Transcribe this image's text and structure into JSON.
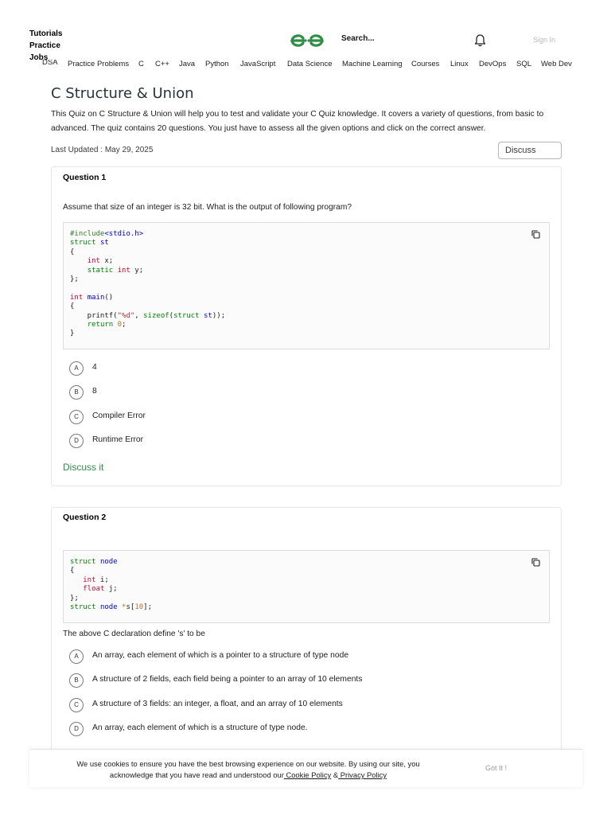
{
  "header": {
    "side_links": [
      "Tutorials",
      "Practice",
      "Jobs"
    ],
    "search_label": "Search...",
    "signin_label": "Sign In",
    "nav_items": [
      "DSA",
      "Practice Problems",
      "C",
      "C++",
      "Java",
      "Python",
      "JavaScript",
      "Data Science",
      "Machine Learning",
      "Courses",
      "Linux",
      "DevOps",
      "SQL",
      "Web Dev"
    ],
    "logo": "gfg-logo-icon",
    "brand_color": "#2f8d46"
  },
  "article": {
    "title": "C Structure & Union",
    "intro": "This Quiz on C Structure & Union will help you to test and validate your C Quiz knowledge. It covers a variety of questions, from basic to advanced. The quiz contains 20 questions. You just have to assess all the given options and click on the correct answer.",
    "updated": "Last Updated : May 29, 2025",
    "discuss_label": "Discuss"
  },
  "questions": [
    {
      "title": "Question 1",
      "text": "Assume that size of an integer is 32 bit. What is the output of following program?",
      "code": "#include<stdio.h>\nstruct st\n{\n    int x;\n    static int y;\n};\n\nint main()\n{\n    printf(\"%d\", sizeof(struct st));\n    return 0;\n}",
      "options": [
        {
          "letter": "A",
          "text": "4"
        },
        {
          "letter": "B",
          "text": "8"
        },
        {
          "letter": "C",
          "text": "Compiler Error"
        },
        {
          "letter": "D",
          "text": "Runtime Error"
        }
      ],
      "discuss_label": "Discuss it"
    },
    {
      "title": "Question 2",
      "text": "The above C declaration define 's' to be",
      "code": "struct node\n{\n   int i;\n   float j;\n};\nstruct node *s[10];",
      "options": [
        {
          "letter": "A",
          "text": "An array, each element of which is a pointer to a structure of type node"
        },
        {
          "letter": "B",
          "text": "A structure of 2 fields, each field being a pointer to an array of 10 elements"
        },
        {
          "letter": "C",
          "text": "A structure of 3 fields: an integer, a float, and an array of 10 elements"
        },
        {
          "letter": "D",
          "text": "An array, each element of which is a structure of type node."
        }
      ]
    }
  ],
  "cookie": {
    "text_line1": "We use cookies to ensure you have the best browsing experience on our website. By using our site, you",
    "text_line2": "acknowledge that you have read and understood our",
    "cookie_policy": " Cookie Policy",
    "amp": " &",
    "privacy_policy": " Privacy Policy",
    "got_it": "Got It !"
  }
}
